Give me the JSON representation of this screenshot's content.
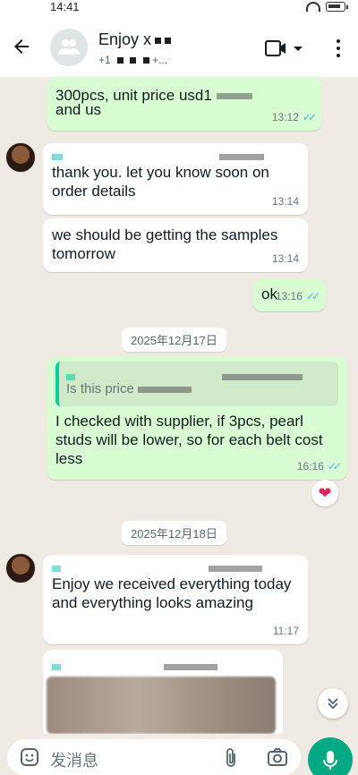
{
  "status": {
    "time": "14:41"
  },
  "header": {
    "title": "Enjoy x",
    "subtitle": "+1",
    "subtitle_tail": "+..."
  },
  "messages": [
    {
      "id": "m1",
      "dir": "out",
      "text": "300pcs, unit price usd1",
      "text2": "and us",
      "time": "13:12"
    },
    {
      "id": "m2",
      "dir": "in",
      "text": "thank you. let you know soon on order details",
      "time": "13:14"
    },
    {
      "id": "m3",
      "dir": "in",
      "text": "we should be getting the samples tomorrow",
      "time": "13:14"
    },
    {
      "id": "m4",
      "dir": "out",
      "text": "ok",
      "time": "13:16"
    },
    {
      "id": "m5",
      "dir": "out",
      "quote": "Is this price",
      "text": "I checked with supplier, if 3pcs, pearl studs will be lower, so for each belt cost less",
      "time": "16:16"
    },
    {
      "id": "m6",
      "dir": "in",
      "text": "Enjoy we received everything today and everything looks amazing",
      "time": "11:17"
    }
  ],
  "dates": {
    "d1": "2025年12月17日",
    "d2": "2025年12月18日"
  },
  "reaction": "❤",
  "composer": {
    "placeholder": "发消息"
  },
  "colors": {
    "outgoing": "#d9fdd3",
    "incoming": "#ffffff",
    "accent": "#00a884",
    "read_ticks": "#53bdeb"
  }
}
